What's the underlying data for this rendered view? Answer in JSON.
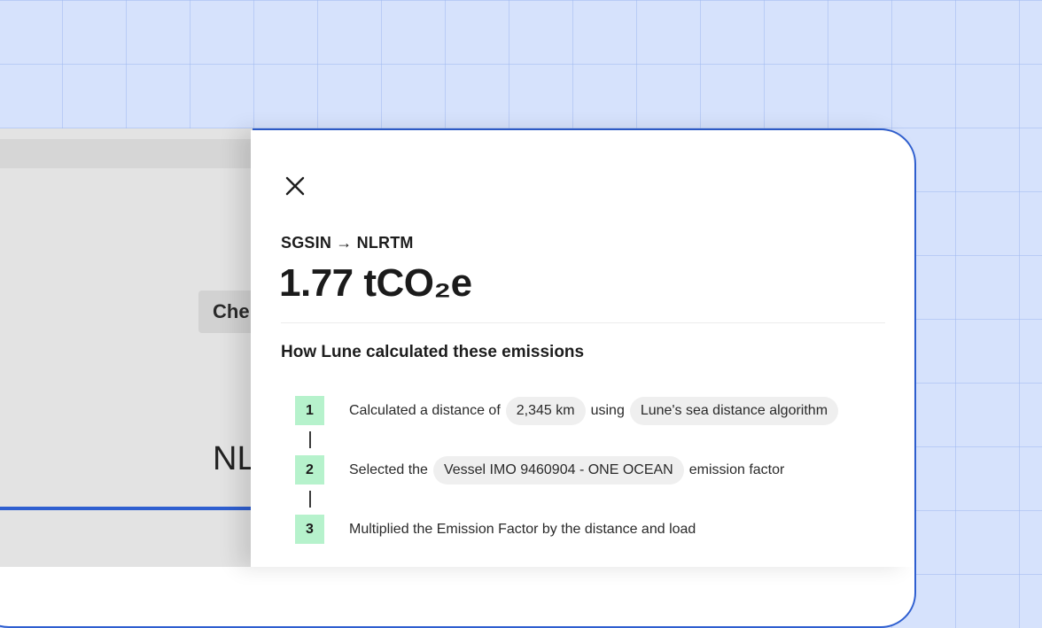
{
  "background_app": {
    "chip_text": "Che",
    "port_text": "NL"
  },
  "panel": {
    "close_icon": "close-icon",
    "route": "SGSIN → NLRTM",
    "total_emissions": "1.77 tCO₂e",
    "methodology_heading": "How Lune calculated these emissions",
    "steps": [
      {
        "number": "1",
        "text_before": "Calculated a distance of",
        "pill_1": "2,345 km",
        "text_middle": "using",
        "pill_2": "Lune's sea distance algorithm"
      },
      {
        "number": "2",
        "text_before": "Selected the",
        "pill_1": "Vessel IMO 9460904 - ONE OCEAN",
        "text_after": "emission factor"
      },
      {
        "number": "3",
        "text": "Multiplied the Emission Factor by the distance and load"
      }
    ]
  },
  "colors": {
    "accent_blue": "#2f5fd0",
    "step_badge_green": "#b6f2cc",
    "page_background": "#d6e2fc"
  }
}
